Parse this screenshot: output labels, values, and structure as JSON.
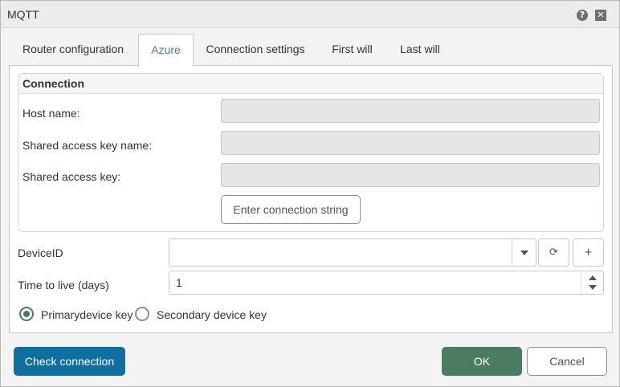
{
  "window": {
    "title": "MQTT",
    "help_icon": "?",
    "close_icon": "✕"
  },
  "tabs": [
    {
      "label": "Router configuration",
      "active": false
    },
    {
      "label": "Azure",
      "active": true
    },
    {
      "label": "Connection settings",
      "active": false
    },
    {
      "label": "First will",
      "active": false
    },
    {
      "label": "Last will",
      "active": false
    }
  ],
  "connection": {
    "title": "Connection",
    "host_name_label": "Host name:",
    "host_name_value": "",
    "shared_key_name_label": "Shared access key name:",
    "shared_key_name_value": "",
    "shared_key_label": "Shared access key:",
    "shared_key_value": "",
    "enter_connection_string": "Enter connection string"
  },
  "device": {
    "device_id_label": "DeviceID",
    "device_id_value": "",
    "refresh_icon": "⟳",
    "add_icon": "+",
    "ttl_label": "Time to live (days)",
    "ttl_value": "1"
  },
  "key_choice": {
    "primary_label": "Primarydevice key",
    "secondary_label": "Secondary device key",
    "selected": "primary"
  },
  "footer": {
    "check_connection": "Check connection",
    "ok": "OK",
    "cancel": "Cancel"
  },
  "colors": {
    "accent_tab": "#4b7e99",
    "primary_button": "#0e6fa0",
    "ok_button": "#4a7c62"
  }
}
